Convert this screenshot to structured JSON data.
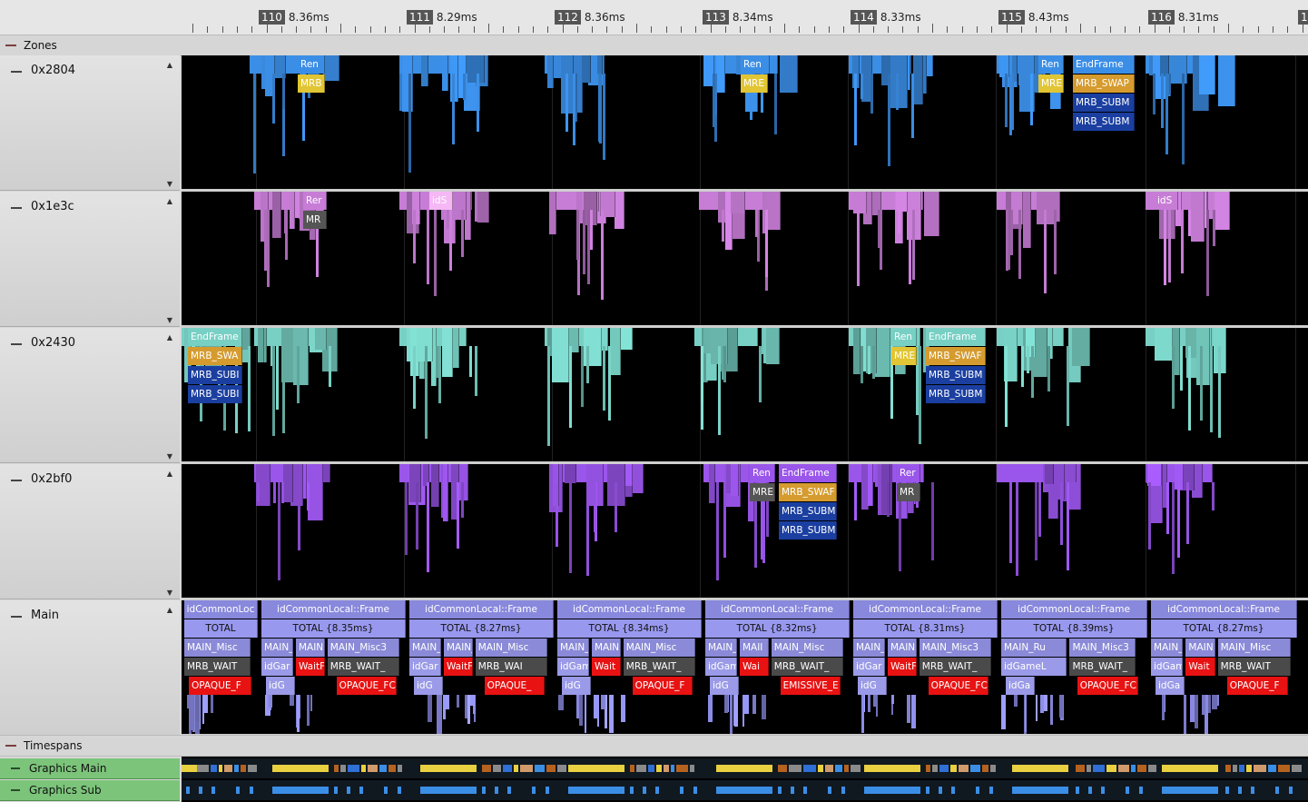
{
  "ruler": {
    "frames": [
      {
        "num": "110",
        "dur": "8.36ms"
      },
      {
        "num": "111",
        "dur": "8.29ms"
      },
      {
        "num": "112",
        "dur": "8.36ms"
      },
      {
        "num": "113",
        "dur": "8.34ms"
      },
      {
        "num": "114",
        "dur": "8.33ms"
      },
      {
        "num": "115",
        "dur": "8.43ms"
      },
      {
        "num": "116",
        "dur": "8.31ms"
      },
      {
        "num": "1",
        "dur": ""
      }
    ]
  },
  "sections": {
    "zones": "Zones",
    "timespans": "Timespans"
  },
  "threads": [
    {
      "name": "0x2804",
      "color": "#3b8ee6",
      "labels": [
        "Ren",
        "MRB",
        "Ren",
        "MRE",
        "Ren",
        "MRE",
        "EndFrame",
        "MRB_SWAP",
        "MRB_SUBM",
        "MRB_SUBM"
      ]
    },
    {
      "name": "0x1e3c",
      "color": "#c77dd6",
      "labels": [
        "Rer",
        "MR",
        "idS",
        "idS"
      ]
    },
    {
      "name": "0x2430",
      "color": "#78d0c4",
      "labels": [
        "EndFrame",
        "MRB_SWA",
        "MRB_SUBI",
        "MRB_SUBI",
        "Ren",
        "MRE",
        "EndFrame",
        "MRB_SWAF",
        "MRB_SUBM",
        "MRB_SUBM"
      ]
    },
    {
      "name": "0x2bf0",
      "color": "#9a55ea",
      "labels": [
        "Ren",
        "MRE",
        "EndFrame",
        "MRB_SWAF",
        "MRB_SUBM",
        "MRB_SUBM",
        "Rer",
        "MR"
      ]
    },
    {
      "name": "Main",
      "color": "#8c8ce6"
    }
  ],
  "main": {
    "frames": [
      {
        "l1": "idCommonLoc",
        "l2": "TOTAL",
        "l3": [
          "MAIN_Misc"
        ],
        "l4": [
          "MRB_WAIT"
        ],
        "l5": [
          "OPAQUE_F"
        ]
      },
      {
        "l1": "idCommonLocal::Frame",
        "l2": "TOTAL {8.35ms}",
        "l3": [
          "MAIN_",
          "MAIN",
          "MAIN_Misc3"
        ],
        "l4": [
          "idGar",
          "WaitF",
          "MRB_WAIT_"
        ],
        "l5": [
          "idG",
          "OPAQUE_FC"
        ]
      },
      {
        "l1": "idCommonLocal::Frame",
        "l2": "TOTAL {8.27ms}",
        "l3": [
          "MAIN_",
          "MAIN_F",
          "MAIN_Misc"
        ],
        "l4": [
          "idGar",
          "WaitF",
          "MRB_WAI"
        ],
        "l5": [
          "idG",
          "OPAQUE_"
        ]
      },
      {
        "l1": "idCommonLocal::Frame",
        "l2": "TOTAL {8.34ms}",
        "l3": [
          "MAIN_F",
          "MAIN",
          "MAIN_Misc"
        ],
        "l4": [
          "idGam",
          "Wait",
          "MRB_WAIT_"
        ],
        "l5": [
          "idG",
          "OPAQUE_F"
        ]
      },
      {
        "l1": "idCommonLocal::Frame",
        "l2": "TOTAL {8.32ms}",
        "l3": [
          "MAIN_F",
          "MAII",
          "MAIN_Misc"
        ],
        "l4": [
          "idGam",
          "Wai",
          "MRB_WAIT_"
        ],
        "l5": [
          "idG",
          "EMISSIVE_E"
        ]
      },
      {
        "l1": "idCommonLocal::Frame",
        "l2": "TOTAL {8.31ms}",
        "l3": [
          "MAIN_",
          "MAIN",
          "MAIN_Misc3"
        ],
        "l4": [
          "idGar",
          "WaitF",
          "MRB_WAIT_"
        ],
        "l5": [
          "idG",
          "OPAQUE_FC"
        ]
      },
      {
        "l1": "idCommonLocal::Frame",
        "l2": "TOTAL {8.39ms}",
        "l3": [
          "MAIN_Ru",
          "MAIN_Misc3"
        ],
        "l4": [
          "idGameL",
          "MRB_WAIT_"
        ],
        "l5": [
          "idGa",
          "OPAQUE_FC"
        ]
      },
      {
        "l1": "idCommonLocal::Frame",
        "l2": "TOTAL {8.27ms}",
        "l3": [
          "MAIN_F",
          "MAIN",
          "MAIN_Misc"
        ],
        "l4": [
          "idGam",
          "Wait",
          "MRB_WAIT"
        ],
        "l5": [
          "idGa",
          "OPAQUE_F"
        ]
      }
    ]
  },
  "timespans": [
    {
      "name": "Graphics Main"
    },
    {
      "name": "Graphics Sub"
    }
  ],
  "colors": {
    "waitRed": "#e81212",
    "mrbGray": "#4a4a4a",
    "total": "#9898ee",
    "frame": "#8888dd"
  }
}
